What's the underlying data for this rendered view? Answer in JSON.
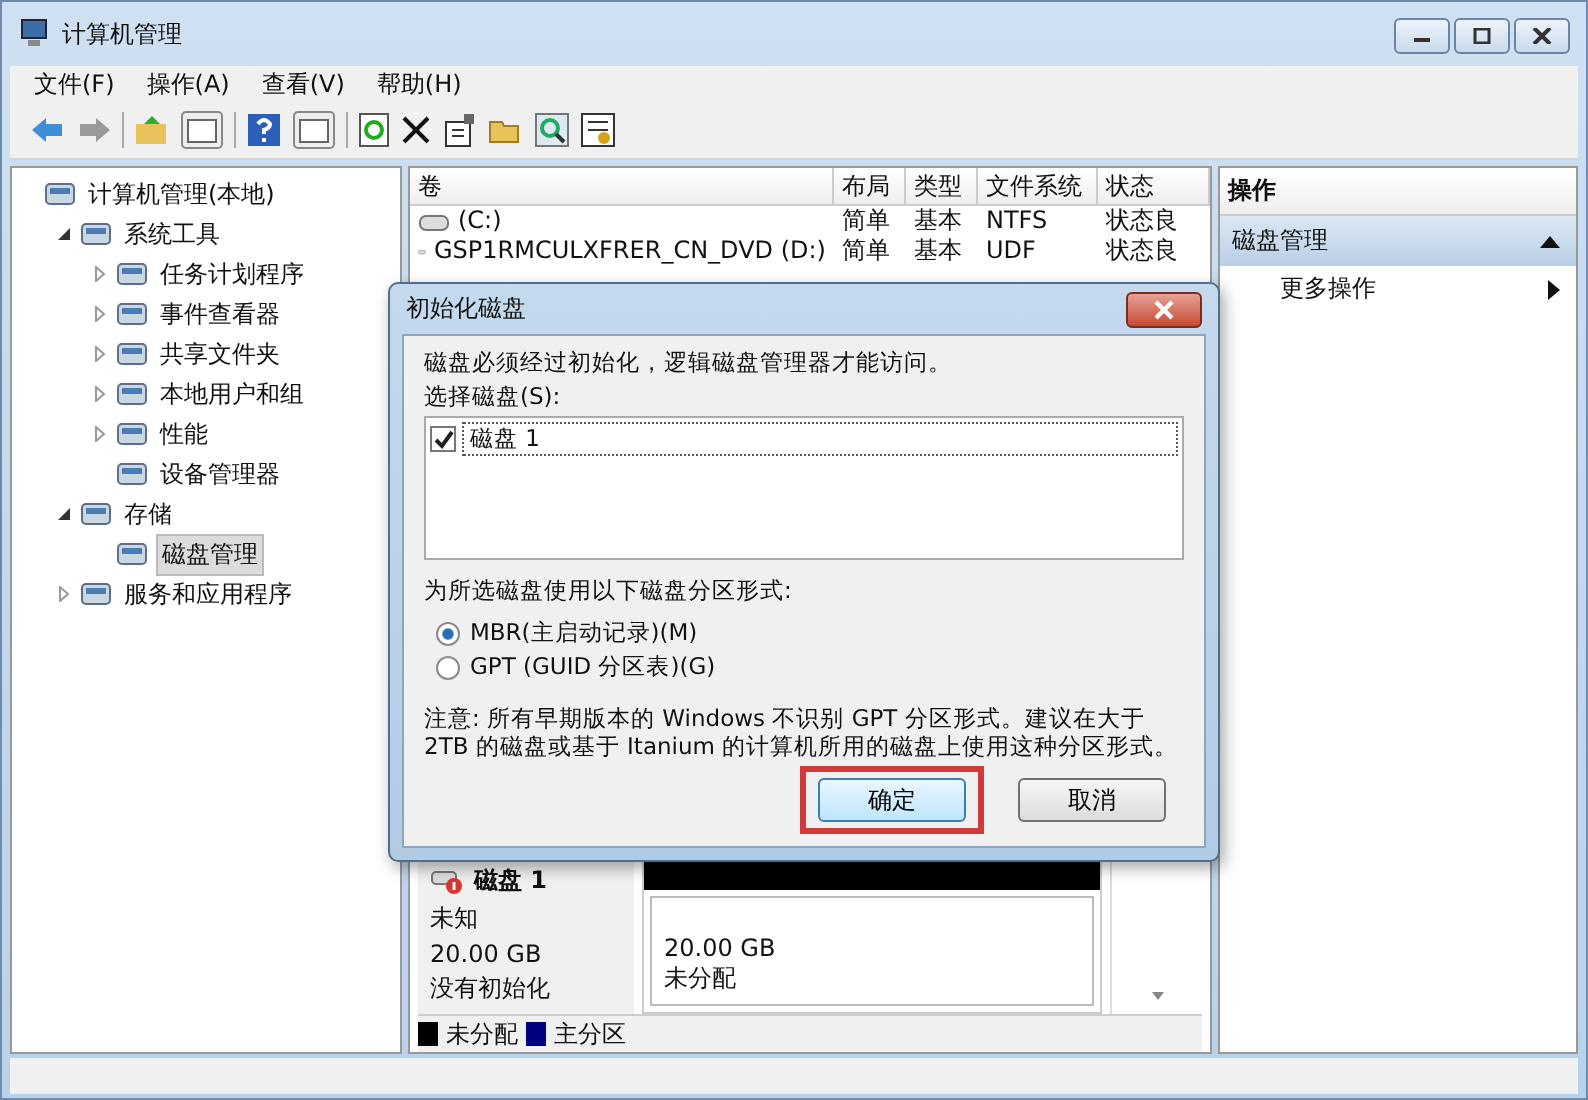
{
  "window": {
    "title": "计算机管理"
  },
  "menu": [
    "文件(F)",
    "操作(A)",
    "查看(V)",
    "帮助(H)"
  ],
  "tree": [
    {
      "label": "计算机管理(本地)",
      "selected": false,
      "children": [
        {
          "label": "系统工具",
          "expanded": true,
          "selected": false,
          "children": [
            {
              "label": "任务计划程序",
              "expanded": false,
              "selected": false
            },
            {
              "label": "事件查看器",
              "expanded": false,
              "selected": false
            },
            {
              "label": "共享文件夹",
              "expanded": false,
              "selected": false
            },
            {
              "label": "本地用户和组",
              "expanded": false,
              "selected": false
            },
            {
              "label": "性能",
              "expanded": false,
              "selected": false
            },
            {
              "label": "设备管理器",
              "selected": false
            }
          ]
        },
        {
          "label": "存储",
          "expanded": true,
          "selected": false,
          "children": [
            {
              "label": "磁盘管理",
              "selected": true
            }
          ]
        },
        {
          "label": "服务和应用程序",
          "expanded": false,
          "selected": false
        }
      ]
    }
  ],
  "volumes": {
    "columns": [
      "卷",
      "布局",
      "类型",
      "文件系统",
      "状态"
    ],
    "rows": [
      [
        "(C:)",
        "简单",
        "基本",
        "NTFS",
        "状态良"
      ],
      [
        "GSP1RMCULXFRER_CN_DVD (D:)",
        "简单",
        "基本",
        "UDF",
        "状态良"
      ]
    ]
  },
  "disk": {
    "name": "磁盘 1",
    "type": "未知",
    "size": "20.00 GB",
    "status": "没有初始化",
    "partition_size": "20.00 GB",
    "partition_status": "未分配"
  },
  "legend": [
    {
      "label": "未分配",
      "color": "#000000"
    },
    {
      "label": "主分区",
      "color": "#000080"
    }
  ],
  "actions": {
    "header": "操作",
    "section": "磁盘管理",
    "items": [
      "更多操作"
    ]
  },
  "dialog": {
    "title": "初始化磁盘",
    "message": "磁盘必须经过初始化，逻辑磁盘管理器才能访问。",
    "select_label": "选择磁盘(S):",
    "disks": [
      {
        "label": "磁盘 1",
        "checked": true
      }
    ],
    "format_label": "为所选磁盘使用以下磁盘分区形式:",
    "options": [
      {
        "label": "MBR(主启动记录)(M)",
        "selected": true
      },
      {
        "label": "GPT (GUID 分区表)(G)",
        "selected": false
      }
    ],
    "note": "注意: 所有早期版本的 Windows 不识别 GPT 分区形式。建议在大于 2TB 的磁盘或基于 Itanium 的计算机所用的磁盘上使用这种分区形式。",
    "buttons": [
      {
        "label": "确定",
        "highlighted": true
      },
      {
        "label": "取消",
        "highlighted": false
      }
    ]
  }
}
